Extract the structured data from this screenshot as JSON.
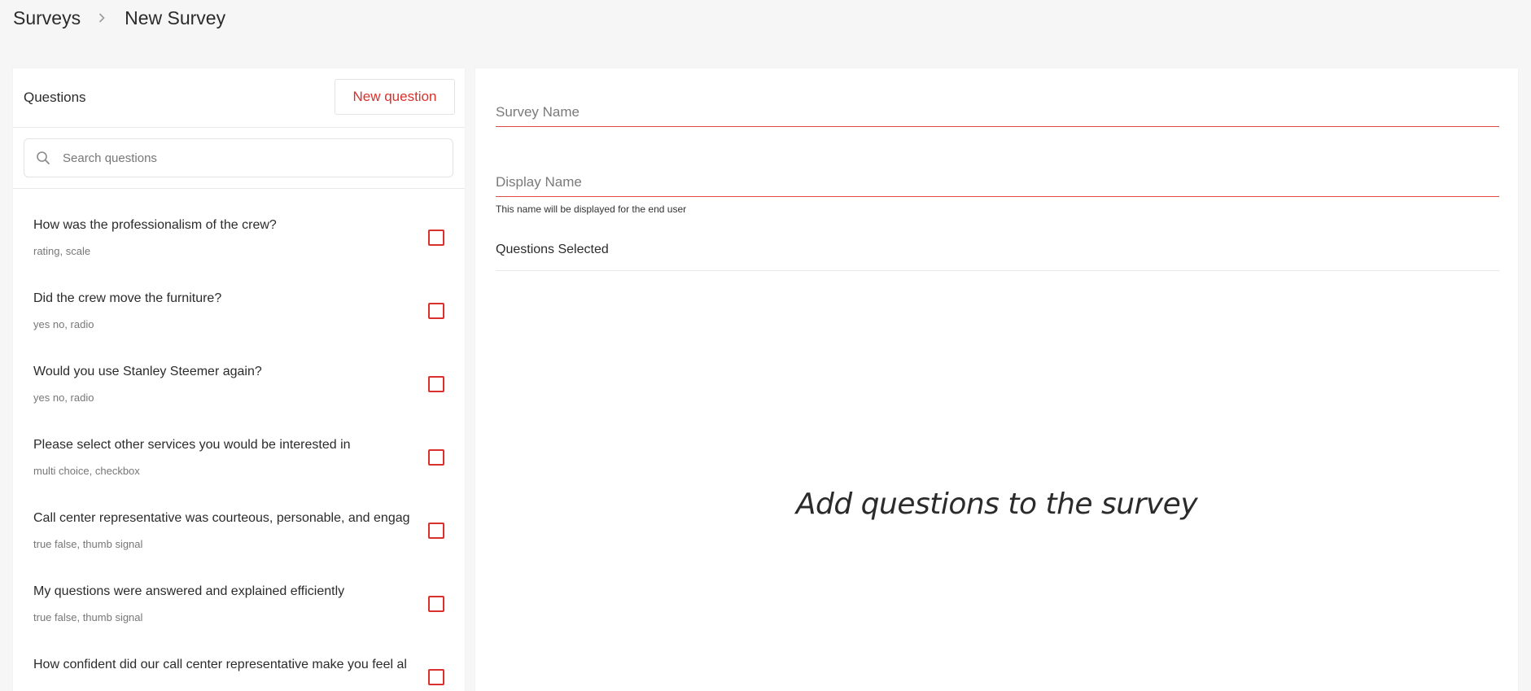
{
  "breadcrumb": {
    "parent": "Surveys",
    "current": "New Survey"
  },
  "questions_panel": {
    "title": "Questions",
    "new_question_label": "New question",
    "search_placeholder": "Search questions",
    "items": [
      {
        "text": "How was the professionalism of the crew?",
        "tags": "rating, scale",
        "checked": false
      },
      {
        "text": "Did the crew move the furniture?",
        "tags": "yes no, radio",
        "checked": false
      },
      {
        "text": "Would you use Stanley Steemer again?",
        "tags": "yes no, radio",
        "checked": false
      },
      {
        "text": "Please select other services you would be interested in",
        "tags": "multi choice, checkbox",
        "checked": false
      },
      {
        "text": "Call center representative was courteous, personable, and engag",
        "tags": "true false, thumb signal",
        "checked": false
      },
      {
        "text": "My questions were answered and explained efficiently",
        "tags": "true false, thumb signal",
        "checked": false
      },
      {
        "text": "How confident did our call center representative make you feel al",
        "tags": "",
        "checked": false
      }
    ]
  },
  "survey_form": {
    "survey_name_placeholder": "Survey Name",
    "display_name_placeholder": "Display Name",
    "display_name_helper": "This name will be displayed for the end user",
    "questions_selected_title": "Questions Selected",
    "empty_message": "Add questions to the survey"
  },
  "colors": {
    "accent": "#d9302c",
    "background": "#f6f6f6",
    "panel": "#ffffff"
  },
  "icons": {
    "breadcrumb_separator": "chevron-right-icon",
    "search": "search-icon"
  }
}
